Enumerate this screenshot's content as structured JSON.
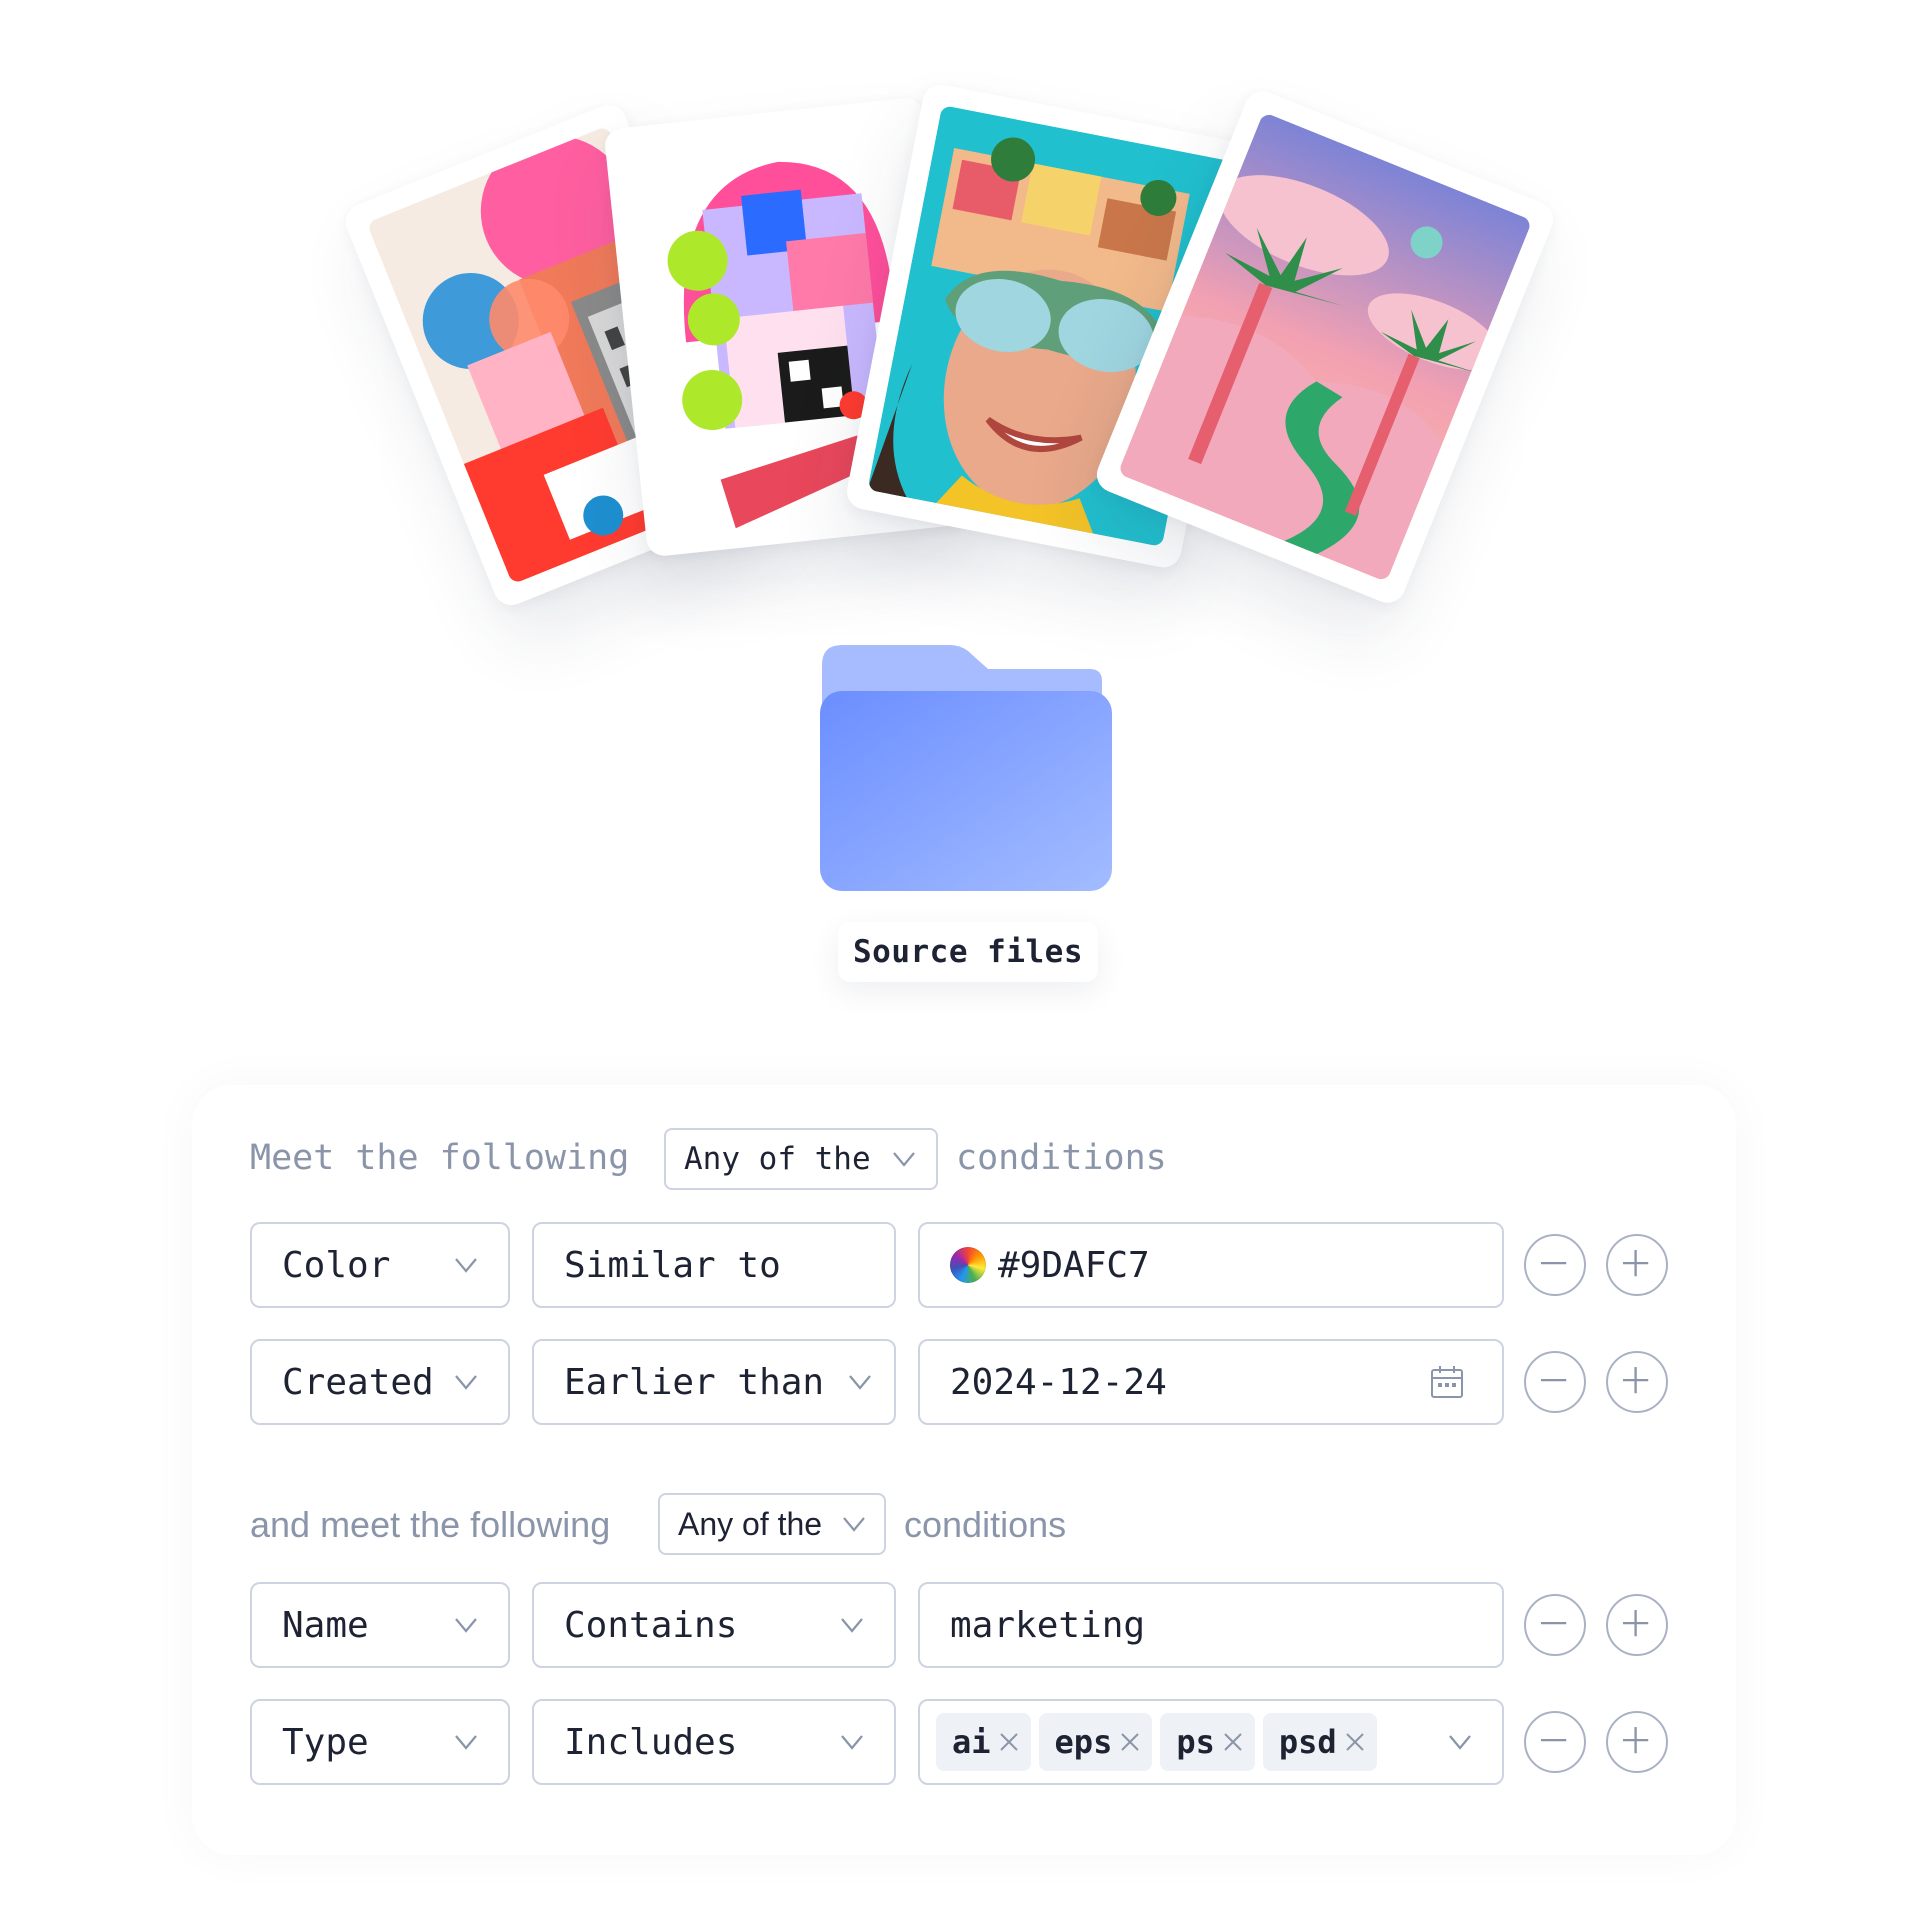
{
  "folder": {
    "label": "Source files",
    "icon": "folder-icon",
    "color_front": "#7b9cff",
    "color_back": "#a6bcff"
  },
  "group1": {
    "prefix": "Meet the following",
    "match_mode": "Any of the",
    "suffix": "conditions",
    "rows": [
      {
        "field": "Color",
        "operator": "Similar to",
        "value": "#9DAFC7"
      },
      {
        "field": "Created",
        "operator": "Earlier than",
        "value": "2024-12-24"
      }
    ]
  },
  "group2": {
    "prefix": "and meet the following",
    "match_mode": "Any of the",
    "suffix": "conditions",
    "rows": [
      {
        "field": "Name",
        "operator": "Contains",
        "value": "marketing"
      },
      {
        "field": "Type",
        "operator": "Includes",
        "tags": [
          "ai",
          "eps",
          "ps",
          "psd"
        ]
      }
    ]
  },
  "colors": {
    "border": "#cdd3e0",
    "muted_text": "#8b95aa",
    "text": "#1d2333",
    "button_border": "#a9b2c4"
  }
}
